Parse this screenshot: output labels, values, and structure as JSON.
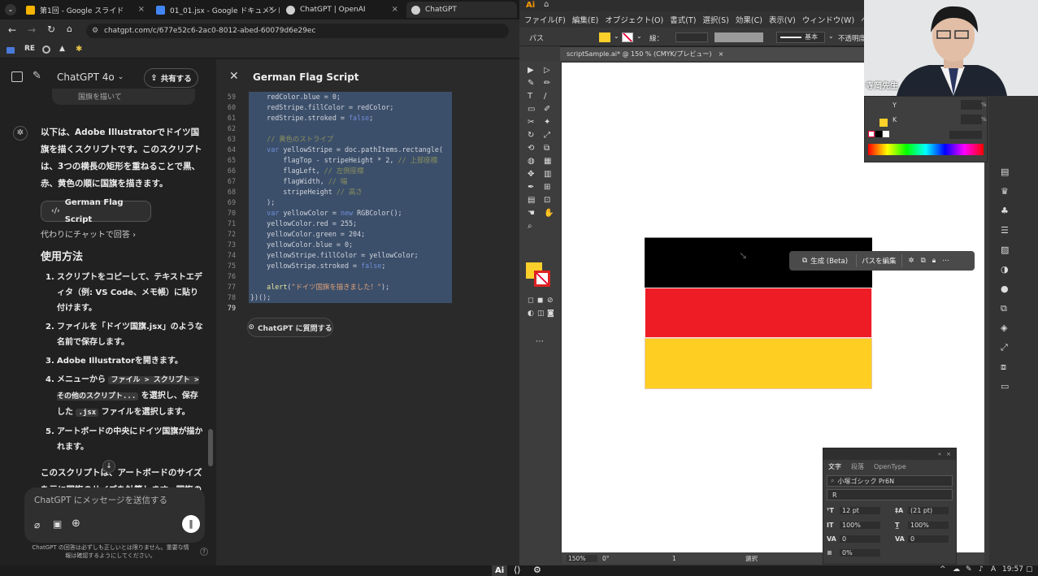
{
  "browser": {
    "tabs": [
      {
        "label": "第1回 - Google スライド",
        "color": "#f4b400"
      },
      {
        "label": "01_01.jsx - Google ドキュメント",
        "color": "#4285f4"
      },
      {
        "label": "ChatGPT | OpenAI",
        "color": "#cfcfcf"
      },
      {
        "label": "ChatGPT",
        "color": "#cfcfcf"
      }
    ],
    "url": "chatgpt.com/c/677e52c6-2ac0-8012-abed-60079d6e29ec",
    "bookmark_label": "RE"
  },
  "chat": {
    "model_label": "ChatGPT 4o",
    "share_label": "共有する",
    "prev_snippet": "国旗を描いて",
    "message": "以下は、Adobe Illustratorでドイツ国旗を描くスクリプトです。このスクリプトは、3つの横長の矩形を重ねることで黒、赤、黄色の順に国旗を描きます。",
    "script_button": "German Flag Script",
    "alt_reply": "代わりにチャットで回答 ›",
    "usage_heading": "使用方法",
    "steps": [
      {
        "n": "1.",
        "text": "スクリプトをコピーして、テキストエディタ（例: VS Code、メモ帳）に貼り付けます。"
      },
      {
        "n": "2.",
        "text": "ファイルを「ドイツ国旗.jsx」のような名前で保存します。"
      },
      {
        "n": "3.",
        "text": "Adobe Illustratorを開きます。"
      },
      {
        "n": "4.",
        "pre": "メニューから",
        "code1": "ファイル > スクリプト > その他のスクリプト...",
        "mid": "を選択し、保存した",
        "code2": ".jsx",
        "post": "ファイルを選択します。"
      },
      {
        "n": "5.",
        "text": "アートボードの中央にドイツ国旗が描かれます。"
      }
    ],
    "tail": "このスクリプトは、アートボードのサイズを元に国旗のサイズを計算します。国旗の位置や大きさ",
    "composer_placeholder": "ChatGPT にメッセージを送信する",
    "disclaimer": "ChatGPT の回答は必ずしも正しいとは限りません。重要な情報は確認するようにしてください。",
    "help": "?"
  },
  "code": {
    "title": "German Flag Script",
    "ask_label": "ChatGPT に質問する",
    "lines": [
      {
        "n": "59",
        "html": "    redColor.blue = 0;",
        "sel": true
      },
      {
        "n": "60",
        "html": "    redStripe.fillColor = redColor;",
        "sel": true
      },
      {
        "n": "61",
        "html": "    redStripe.stroked = <span class=\"kw\">false</span>;",
        "sel": true
      },
      {
        "n": "62",
        "html": "",
        "sel": true
      },
      {
        "n": "63",
        "html": "    <span class=\"cm\">// 黄色のストライプ</span>",
        "sel": true
      },
      {
        "n": "64",
        "html": "    <span class=\"kw\">var</span> yellowStripe = doc.pathItems.rectangle(",
        "sel": true
      },
      {
        "n": "65",
        "html": "        flagTop - stripeHeight * 2, <span class=\"cm\">// 上部座標</span>",
        "sel": true
      },
      {
        "n": "66",
        "html": "        flagLeft, <span class=\"cm\">// 左側座標</span>",
        "sel": true
      },
      {
        "n": "67",
        "html": "        flagWidth, <span class=\"cm\">// 幅</span>",
        "sel": true
      },
      {
        "n": "68",
        "html": "        stripeHeight <span class=\"cm\">// 高さ</span>",
        "sel": true
      },
      {
        "n": "69",
        "html": "    );",
        "sel": true
      },
      {
        "n": "70",
        "html": "    <span class=\"kw\">var</span> yellowColor = <span class=\"kw\">new</span> RGBColor();",
        "sel": true
      },
      {
        "n": "71",
        "html": "    yellowColor.red = 255;",
        "sel": true
      },
      {
        "n": "72",
        "html": "    yellowColor.green = 204;",
        "sel": true
      },
      {
        "n": "73",
        "html": "    yellowColor.blue = 0;",
        "sel": true
      },
      {
        "n": "74",
        "html": "    yellowStripe.fillColor = yellowColor;",
        "sel": true
      },
      {
        "n": "75",
        "html": "    yellowStripe.stroked = <span class=\"kw\">false</span>;",
        "sel": true
      },
      {
        "n": "76",
        "html": "",
        "sel": true
      },
      {
        "n": "77",
        "html": "    <span class=\"fn\">alert</span>(<span class=\"st\">\"ドイツ国旗を描きました！\"</span>);",
        "sel": true
      },
      {
        "n": "78",
        "html": "})();",
        "sel": true
      },
      {
        "n": "79",
        "html": "",
        "sel": false,
        "cur": true
      }
    ]
  },
  "illustrator": {
    "menu": [
      "ファイル(F)",
      "編集(E)",
      "オブジェクト(O)",
      "書式(T)",
      "選択(S)",
      "効果(C)",
      "表示(V)",
      "ウィンドウ(W)",
      "ヘルプ(H)"
    ],
    "option_label": "パス",
    "stroke_label": "線：",
    "basic_label": "基本",
    "opacity_label": "不透明度",
    "doc_tab": "scriptSample.ai* @ 150 % (CMYK/プレビュー)",
    "context_gen": "生成 (Beta)",
    "context_edit": "パスを編集",
    "flag_colors": [
      "#000000",
      "#ee1c25",
      "#ffce22"
    ],
    "fill_color": "#fccf2a",
    "status_zoom": "150%",
    "status_angle": "0°",
    "status_board": "1",
    "status_tool": "選択",
    "color_panel": {
      "y": "Y",
      "k": "K",
      "pct": "%"
    },
    "type_panel": {
      "tabs": [
        "文字",
        "段落",
        "OpenType"
      ],
      "font": "小塚ゴシック Pr6N",
      "style": "R",
      "size": "12 pt",
      "leading": "(21 pt)",
      "hscale": "100%",
      "vscale": "100%",
      "kern": "0",
      "track": "0",
      "baseline": "0%"
    }
  },
  "webcam": {
    "name": "寺岡先生"
  },
  "taskbar": {
    "time": "19:57",
    "ai_label": "Ai",
    "ime": "A"
  }
}
